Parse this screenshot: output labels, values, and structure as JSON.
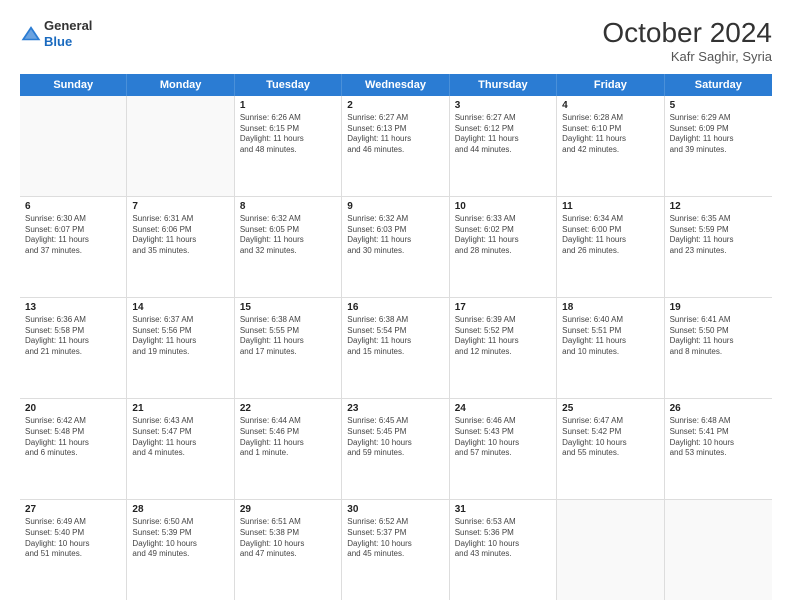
{
  "header": {
    "logo_general": "General",
    "logo_blue": "Blue",
    "month_year": "October 2024",
    "location": "Kafr Saghir, Syria"
  },
  "days_of_week": [
    "Sunday",
    "Monday",
    "Tuesday",
    "Wednesday",
    "Thursday",
    "Friday",
    "Saturday"
  ],
  "rows": [
    [
      {
        "day": "",
        "lines": [],
        "empty": true
      },
      {
        "day": "",
        "lines": [],
        "empty": true
      },
      {
        "day": "1",
        "lines": [
          "Sunrise: 6:26 AM",
          "Sunset: 6:15 PM",
          "Daylight: 11 hours",
          "and 48 minutes."
        ]
      },
      {
        "day": "2",
        "lines": [
          "Sunrise: 6:27 AM",
          "Sunset: 6:13 PM",
          "Daylight: 11 hours",
          "and 46 minutes."
        ]
      },
      {
        "day": "3",
        "lines": [
          "Sunrise: 6:27 AM",
          "Sunset: 6:12 PM",
          "Daylight: 11 hours",
          "and 44 minutes."
        ]
      },
      {
        "day": "4",
        "lines": [
          "Sunrise: 6:28 AM",
          "Sunset: 6:10 PM",
          "Daylight: 11 hours",
          "and 42 minutes."
        ]
      },
      {
        "day": "5",
        "lines": [
          "Sunrise: 6:29 AM",
          "Sunset: 6:09 PM",
          "Daylight: 11 hours",
          "and 39 minutes."
        ]
      }
    ],
    [
      {
        "day": "6",
        "lines": [
          "Sunrise: 6:30 AM",
          "Sunset: 6:07 PM",
          "Daylight: 11 hours",
          "and 37 minutes."
        ]
      },
      {
        "day": "7",
        "lines": [
          "Sunrise: 6:31 AM",
          "Sunset: 6:06 PM",
          "Daylight: 11 hours",
          "and 35 minutes."
        ]
      },
      {
        "day": "8",
        "lines": [
          "Sunrise: 6:32 AM",
          "Sunset: 6:05 PM",
          "Daylight: 11 hours",
          "and 32 minutes."
        ]
      },
      {
        "day": "9",
        "lines": [
          "Sunrise: 6:32 AM",
          "Sunset: 6:03 PM",
          "Daylight: 11 hours",
          "and 30 minutes."
        ]
      },
      {
        "day": "10",
        "lines": [
          "Sunrise: 6:33 AM",
          "Sunset: 6:02 PM",
          "Daylight: 11 hours",
          "and 28 minutes."
        ]
      },
      {
        "day": "11",
        "lines": [
          "Sunrise: 6:34 AM",
          "Sunset: 6:00 PM",
          "Daylight: 11 hours",
          "and 26 minutes."
        ]
      },
      {
        "day": "12",
        "lines": [
          "Sunrise: 6:35 AM",
          "Sunset: 5:59 PM",
          "Daylight: 11 hours",
          "and 23 minutes."
        ]
      }
    ],
    [
      {
        "day": "13",
        "lines": [
          "Sunrise: 6:36 AM",
          "Sunset: 5:58 PM",
          "Daylight: 11 hours",
          "and 21 minutes."
        ]
      },
      {
        "day": "14",
        "lines": [
          "Sunrise: 6:37 AM",
          "Sunset: 5:56 PM",
          "Daylight: 11 hours",
          "and 19 minutes."
        ]
      },
      {
        "day": "15",
        "lines": [
          "Sunrise: 6:38 AM",
          "Sunset: 5:55 PM",
          "Daylight: 11 hours",
          "and 17 minutes."
        ]
      },
      {
        "day": "16",
        "lines": [
          "Sunrise: 6:38 AM",
          "Sunset: 5:54 PM",
          "Daylight: 11 hours",
          "and 15 minutes."
        ]
      },
      {
        "day": "17",
        "lines": [
          "Sunrise: 6:39 AM",
          "Sunset: 5:52 PM",
          "Daylight: 11 hours",
          "and 12 minutes."
        ]
      },
      {
        "day": "18",
        "lines": [
          "Sunrise: 6:40 AM",
          "Sunset: 5:51 PM",
          "Daylight: 11 hours",
          "and 10 minutes."
        ]
      },
      {
        "day": "19",
        "lines": [
          "Sunrise: 6:41 AM",
          "Sunset: 5:50 PM",
          "Daylight: 11 hours",
          "and 8 minutes."
        ]
      }
    ],
    [
      {
        "day": "20",
        "lines": [
          "Sunrise: 6:42 AM",
          "Sunset: 5:48 PM",
          "Daylight: 11 hours",
          "and 6 minutes."
        ]
      },
      {
        "day": "21",
        "lines": [
          "Sunrise: 6:43 AM",
          "Sunset: 5:47 PM",
          "Daylight: 11 hours",
          "and 4 minutes."
        ]
      },
      {
        "day": "22",
        "lines": [
          "Sunrise: 6:44 AM",
          "Sunset: 5:46 PM",
          "Daylight: 11 hours",
          "and 1 minute."
        ]
      },
      {
        "day": "23",
        "lines": [
          "Sunrise: 6:45 AM",
          "Sunset: 5:45 PM",
          "Daylight: 10 hours",
          "and 59 minutes."
        ]
      },
      {
        "day": "24",
        "lines": [
          "Sunrise: 6:46 AM",
          "Sunset: 5:43 PM",
          "Daylight: 10 hours",
          "and 57 minutes."
        ]
      },
      {
        "day": "25",
        "lines": [
          "Sunrise: 6:47 AM",
          "Sunset: 5:42 PM",
          "Daylight: 10 hours",
          "and 55 minutes."
        ]
      },
      {
        "day": "26",
        "lines": [
          "Sunrise: 6:48 AM",
          "Sunset: 5:41 PM",
          "Daylight: 10 hours",
          "and 53 minutes."
        ]
      }
    ],
    [
      {
        "day": "27",
        "lines": [
          "Sunrise: 6:49 AM",
          "Sunset: 5:40 PM",
          "Daylight: 10 hours",
          "and 51 minutes."
        ]
      },
      {
        "day": "28",
        "lines": [
          "Sunrise: 6:50 AM",
          "Sunset: 5:39 PM",
          "Daylight: 10 hours",
          "and 49 minutes."
        ]
      },
      {
        "day": "29",
        "lines": [
          "Sunrise: 6:51 AM",
          "Sunset: 5:38 PM",
          "Daylight: 10 hours",
          "and 47 minutes."
        ]
      },
      {
        "day": "30",
        "lines": [
          "Sunrise: 6:52 AM",
          "Sunset: 5:37 PM",
          "Daylight: 10 hours",
          "and 45 minutes."
        ]
      },
      {
        "day": "31",
        "lines": [
          "Sunrise: 6:53 AM",
          "Sunset: 5:36 PM",
          "Daylight: 10 hours",
          "and 43 minutes."
        ]
      },
      {
        "day": "",
        "lines": [],
        "empty": true
      },
      {
        "day": "",
        "lines": [],
        "empty": true
      }
    ]
  ]
}
